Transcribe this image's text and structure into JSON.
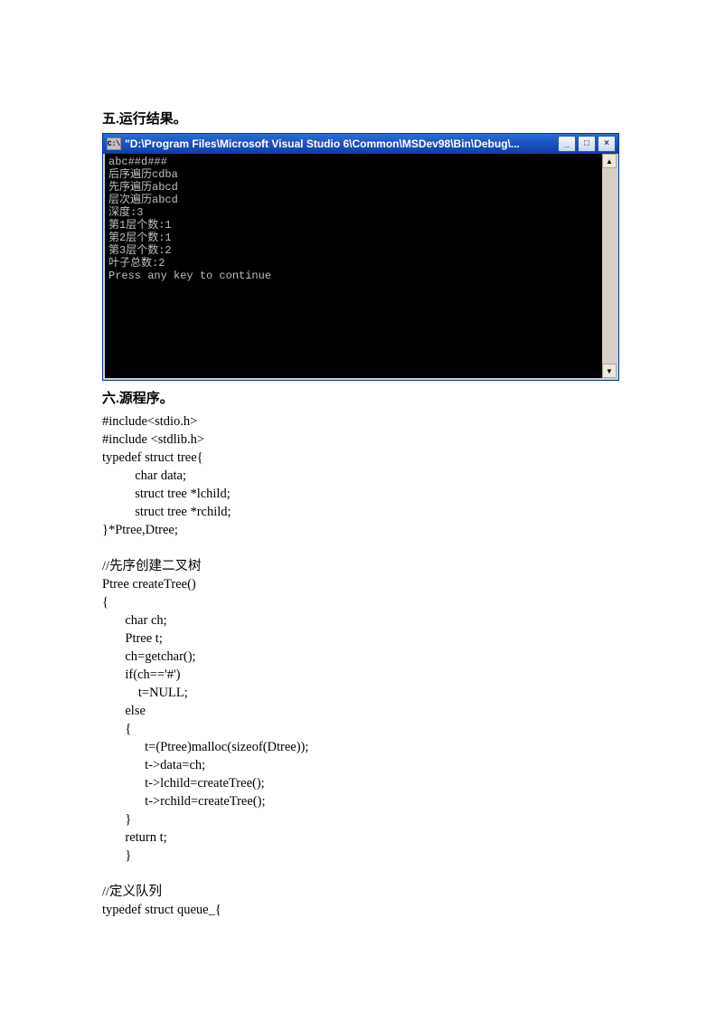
{
  "section5": {
    "title": "五.运行结果。"
  },
  "window": {
    "icon_label": "C:\\",
    "title": "\"D:\\Program Files\\Microsoft Visual Studio 6\\Common\\MSDev98\\Bin\\Debug\\...",
    "min_glyph": "_",
    "max_glyph": "□",
    "close_glyph": "×",
    "scroll_up": "▲",
    "scroll_down": "▼"
  },
  "console_output": "abc##d###\n后序遍历cdba\n先序遍历abcd\n层次遍历abcd\n深度:3\n第1层个数:1\n第2层个数:1\n第3层个数:2\n叶子总数:2\nPress any key to continue",
  "section6": {
    "title": "六.源程序。"
  },
  "code": "#include<stdio.h>\n#include <stdlib.h>\ntypedef struct tree{\n          char data;\n          struct tree *lchild;\n          struct tree *rchild;\n}*Ptree,Dtree;\n\n//先序创建二叉树\nPtree createTree()\n{\n       char ch;\n       Ptree t;\n       ch=getchar();\n       if(ch=='#')\n           t=NULL;\n       else\n       {\n             t=(Ptree)malloc(sizeof(Dtree));\n             t->data=ch;\n             t->lchild=createTree();\n             t->rchild=createTree();\n       }\n       return t;\n       }\n\n//定义队列\ntypedef struct queue_{"
}
